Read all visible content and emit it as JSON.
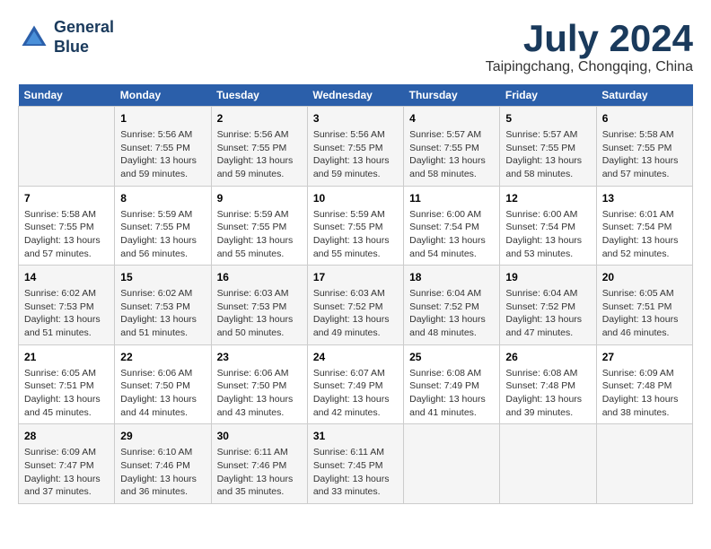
{
  "header": {
    "logo_line1": "General",
    "logo_line2": "Blue",
    "month_title": "July 2024",
    "location": "Taipingchang, Chongqing, China"
  },
  "days_of_week": [
    "Sunday",
    "Monday",
    "Tuesday",
    "Wednesday",
    "Thursday",
    "Friday",
    "Saturday"
  ],
  "weeks": [
    [
      {
        "day": "",
        "info": ""
      },
      {
        "day": "1",
        "info": "Sunrise: 5:56 AM\nSunset: 7:55 PM\nDaylight: 13 hours and 59 minutes."
      },
      {
        "day": "2",
        "info": "Sunrise: 5:56 AM\nSunset: 7:55 PM\nDaylight: 13 hours and 59 minutes."
      },
      {
        "day": "3",
        "info": "Sunrise: 5:56 AM\nSunset: 7:55 PM\nDaylight: 13 hours and 59 minutes."
      },
      {
        "day": "4",
        "info": "Sunrise: 5:57 AM\nSunset: 7:55 PM\nDaylight: 13 hours and 58 minutes."
      },
      {
        "day": "5",
        "info": "Sunrise: 5:57 AM\nSunset: 7:55 PM\nDaylight: 13 hours and 58 minutes."
      },
      {
        "day": "6",
        "info": "Sunrise: 5:58 AM\nSunset: 7:55 PM\nDaylight: 13 hours and 57 minutes."
      }
    ],
    [
      {
        "day": "7",
        "info": "Sunrise: 5:58 AM\nSunset: 7:55 PM\nDaylight: 13 hours and 57 minutes."
      },
      {
        "day": "8",
        "info": "Sunrise: 5:59 AM\nSunset: 7:55 PM\nDaylight: 13 hours and 56 minutes."
      },
      {
        "day": "9",
        "info": "Sunrise: 5:59 AM\nSunset: 7:55 PM\nDaylight: 13 hours and 55 minutes."
      },
      {
        "day": "10",
        "info": "Sunrise: 5:59 AM\nSunset: 7:55 PM\nDaylight: 13 hours and 55 minutes."
      },
      {
        "day": "11",
        "info": "Sunrise: 6:00 AM\nSunset: 7:54 PM\nDaylight: 13 hours and 54 minutes."
      },
      {
        "day": "12",
        "info": "Sunrise: 6:00 AM\nSunset: 7:54 PM\nDaylight: 13 hours and 53 minutes."
      },
      {
        "day": "13",
        "info": "Sunrise: 6:01 AM\nSunset: 7:54 PM\nDaylight: 13 hours and 52 minutes."
      }
    ],
    [
      {
        "day": "14",
        "info": "Sunrise: 6:02 AM\nSunset: 7:53 PM\nDaylight: 13 hours and 51 minutes."
      },
      {
        "day": "15",
        "info": "Sunrise: 6:02 AM\nSunset: 7:53 PM\nDaylight: 13 hours and 51 minutes."
      },
      {
        "day": "16",
        "info": "Sunrise: 6:03 AM\nSunset: 7:53 PM\nDaylight: 13 hours and 50 minutes."
      },
      {
        "day": "17",
        "info": "Sunrise: 6:03 AM\nSunset: 7:52 PM\nDaylight: 13 hours and 49 minutes."
      },
      {
        "day": "18",
        "info": "Sunrise: 6:04 AM\nSunset: 7:52 PM\nDaylight: 13 hours and 48 minutes."
      },
      {
        "day": "19",
        "info": "Sunrise: 6:04 AM\nSunset: 7:52 PM\nDaylight: 13 hours and 47 minutes."
      },
      {
        "day": "20",
        "info": "Sunrise: 6:05 AM\nSunset: 7:51 PM\nDaylight: 13 hours and 46 minutes."
      }
    ],
    [
      {
        "day": "21",
        "info": "Sunrise: 6:05 AM\nSunset: 7:51 PM\nDaylight: 13 hours and 45 minutes."
      },
      {
        "day": "22",
        "info": "Sunrise: 6:06 AM\nSunset: 7:50 PM\nDaylight: 13 hours and 44 minutes."
      },
      {
        "day": "23",
        "info": "Sunrise: 6:06 AM\nSunset: 7:50 PM\nDaylight: 13 hours and 43 minutes."
      },
      {
        "day": "24",
        "info": "Sunrise: 6:07 AM\nSunset: 7:49 PM\nDaylight: 13 hours and 42 minutes."
      },
      {
        "day": "25",
        "info": "Sunrise: 6:08 AM\nSunset: 7:49 PM\nDaylight: 13 hours and 41 minutes."
      },
      {
        "day": "26",
        "info": "Sunrise: 6:08 AM\nSunset: 7:48 PM\nDaylight: 13 hours and 39 minutes."
      },
      {
        "day": "27",
        "info": "Sunrise: 6:09 AM\nSunset: 7:48 PM\nDaylight: 13 hours and 38 minutes."
      }
    ],
    [
      {
        "day": "28",
        "info": "Sunrise: 6:09 AM\nSunset: 7:47 PM\nDaylight: 13 hours and 37 minutes."
      },
      {
        "day": "29",
        "info": "Sunrise: 6:10 AM\nSunset: 7:46 PM\nDaylight: 13 hours and 36 minutes."
      },
      {
        "day": "30",
        "info": "Sunrise: 6:11 AM\nSunset: 7:46 PM\nDaylight: 13 hours and 35 minutes."
      },
      {
        "day": "31",
        "info": "Sunrise: 6:11 AM\nSunset: 7:45 PM\nDaylight: 13 hours and 33 minutes."
      },
      {
        "day": "",
        "info": ""
      },
      {
        "day": "",
        "info": ""
      },
      {
        "day": "",
        "info": ""
      }
    ]
  ]
}
